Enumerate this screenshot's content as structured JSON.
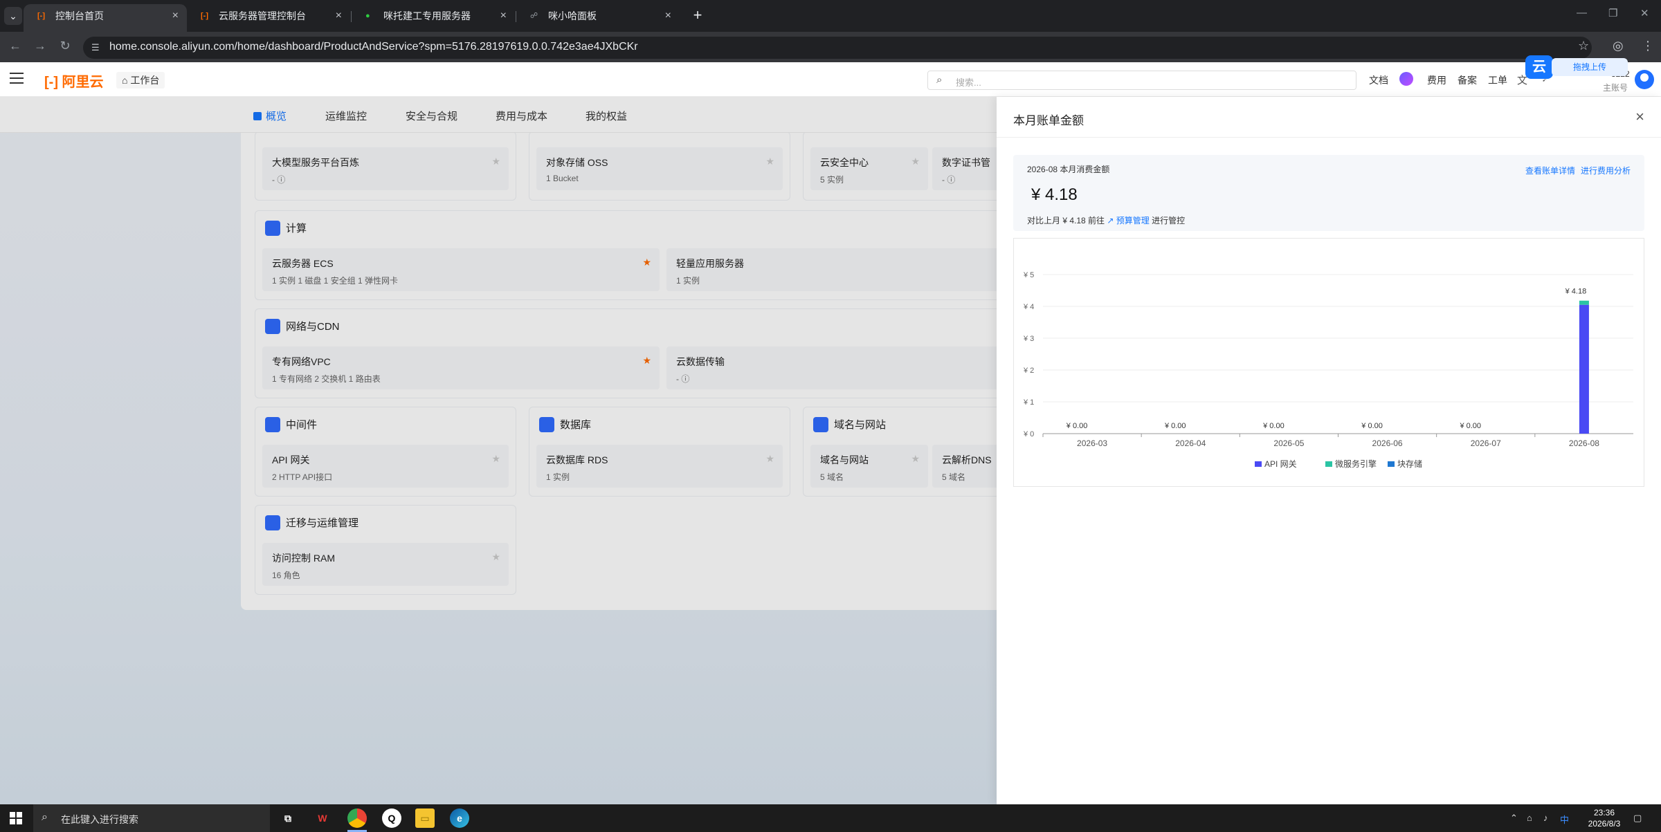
{
  "browser": {
    "tabs": [
      {
        "title": "控制台首页",
        "active": true
      },
      {
        "title": "云服务器管理控制台",
        "active": false
      },
      {
        "title": "咪托建工专用服务器",
        "active": false
      },
      {
        "title": "咪小哈面板",
        "active": false
      }
    ],
    "url": "home.console.aliyun.com/home/dashboard/ProductAndService?spm=5176.28197619.0.0.742e3ae4JXbCKr"
  },
  "console": {
    "logo": "阿里云",
    "workbench": "工作台",
    "search_placeholder": "搜索...",
    "top_links": [
      "文档",
      "费用",
      "备案",
      "工单"
    ],
    "account_id": "3222",
    "account_role": "主账号",
    "upload_label": "拖拽上传",
    "upload_icon": "云"
  },
  "dashboard": {
    "subnav": [
      "概览",
      "运维监控",
      "安全与合规",
      "费用与成本",
      "我的权益"
    ],
    "sections": {
      "compute": "计算",
      "network": "网络与CDN",
      "middleware": "中间件",
      "database": "数据库",
      "domain": "域名与网站",
      "migration": "迁移与运维管理"
    },
    "items": {
      "bailian": {
        "name": "大模型服务平台百炼",
        "sub": "- ⓘ"
      },
      "oss": {
        "name": "对象存储 OSS",
        "sub": "1 Bucket"
      },
      "security": {
        "name": "云安全中心",
        "sub": "5 实例"
      },
      "cert": {
        "name": "数字证书管",
        "sub": "- ⓘ"
      },
      "ecs": {
        "name": "云服务器 ECS",
        "sub": "1 实例    1 磁盘    1 安全组    1 弹性网卡"
      },
      "swas": {
        "name": "轻量应用服务器",
        "sub": "1 实例"
      },
      "vpc": {
        "name": "专有网络VPC",
        "sub": "1 专有网络    2 交换机    1 路由表"
      },
      "cdt": {
        "name": "云数据传输",
        "sub": "- ⓘ"
      },
      "apigw": {
        "name": "API 网关",
        "sub": "2 HTTP API接口"
      },
      "rds": {
        "name": "云数据库 RDS",
        "sub": "1 实例"
      },
      "domain": {
        "name": "域名与网站",
        "sub": "5 域名"
      },
      "dns": {
        "name": "云解析DNS",
        "sub": "5 域名"
      },
      "ram": {
        "name": "访问控制 RAM",
        "sub": "16 角色"
      }
    }
  },
  "drawer": {
    "title": "本月账单金额",
    "summary_label": "2026-08 本月消费金额",
    "link_detail": "查看账单详情",
    "link_analysis": "进行费用分析",
    "amount": "¥  4.18",
    "compare_prefix": "对比上月 ¥ 4.18 前往",
    "compare_link": "↗ 预算管理",
    "compare_suffix": "进行管控"
  },
  "chart_data": {
    "type": "bar",
    "stacked": true,
    "categories": [
      "2026-03",
      "2026-04",
      "2026-05",
      "2026-06",
      "2026-07",
      "2026-08"
    ],
    "series": [
      {
        "name": "API 网关",
        "color": "#4a4af4",
        "values": [
          0,
          0,
          0,
          0,
          0,
          4.05
        ]
      },
      {
        "name": "微服务引擎",
        "color": "#2bc4a4",
        "values": [
          0,
          0,
          0,
          0,
          0,
          0.13
        ]
      },
      {
        "name": "块存储",
        "color": "#1f78d1",
        "values": [
          0,
          0,
          0,
          0,
          0,
          0
        ]
      }
    ],
    "totals": [
      "¥ 0.00",
      "¥ 0.00",
      "¥ 0.00",
      "¥ 0.00",
      "¥ 0.00",
      "¥ 4.18"
    ],
    "ylim": [
      0,
      5
    ],
    "yticks": [
      "¥ 0",
      "¥ 1",
      "¥ 2",
      "¥ 3",
      "¥ 4",
      "¥ 5"
    ],
    "legend_position": "bottom"
  },
  "taskbar": {
    "search_placeholder": "在此键入进行搜索",
    "time": "23:36",
    "date": "2026/8/3"
  }
}
